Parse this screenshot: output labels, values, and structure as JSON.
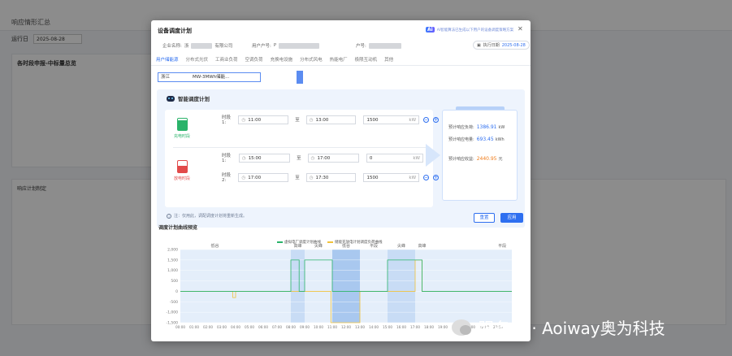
{
  "background": {
    "page_title": "响应情形汇总",
    "filter_label": "运行日",
    "filter_date": "2025-08-28",
    "section_title": "各时段申报-中标量总览",
    "response_label": "响应计划制定"
  },
  "modal": {
    "title": "设备调度计划",
    "ai_badge": "Ai",
    "ai_text": "AI智能算法已生成以下用户的设备调度策略方案",
    "enterprise_label": "企业名称:",
    "enterprise_value": "浙",
    "enterprise_suffix": "有限公司",
    "user_label": "用户户号:",
    "user_value": "P",
    "account_label": "户号:",
    "exec_label": "执行日期",
    "exec_date": "2025-08-28",
    "tabs": [
      "用户储能源",
      "分布式光伏",
      "工商业负荷",
      "空调负荷",
      "充换电设施",
      "分布式风电",
      "热能电厂",
      "极限互动机",
      "其他"
    ],
    "region_value": "浙江",
    "region_value2": "MW-3MWh储能...",
    "plan_title": "智能调度计划",
    "charge_label": "充电时段",
    "discharge_label": "放电时段",
    "to_label": "至",
    "kw_unit": "kW",
    "charge_rows": [
      {
        "label": "时段1:",
        "start": "11:00",
        "end": "13:00",
        "power": "1500"
      }
    ],
    "discharge_rows": [
      {
        "label": "时段1:",
        "start": "15:00",
        "end": "17:00",
        "power": "0"
      },
      {
        "label": "时段2:",
        "start": "17:00",
        "end": "17:30",
        "power": "1500"
      }
    ],
    "note": "注：仅用此，调配调度计划将重新生成。",
    "results": {
      "load_label": "预计响应负荷:",
      "load_value": "1386.91",
      "load_unit": "kW",
      "energy_label": "预计响应电量:",
      "energy_value": "693.45",
      "energy_unit": "kWh",
      "income_label": "预计响应收益:",
      "income_value": "2440.95",
      "income_unit": "元"
    },
    "reset_label": "重置",
    "apply_label": "应用",
    "chart_title": "调度计划曲线预览"
  },
  "chart_data": {
    "type": "line",
    "legend": [
      "虚拟电厂调度计划曲线",
      "储能充放电计划调度负荷曲线"
    ],
    "colors": {
      "dispatch": "#2ab36a",
      "storage": "#f0c23b",
      "band": "#c8dcf5",
      "band_dark": "#a9c8ef"
    },
    "periods": [
      "低谷",
      "高峰",
      "尖峰",
      "低谷",
      "平段",
      "尖峰",
      "高峰",
      "平段"
    ],
    "y_ticks": [
      "2,000",
      "1,500",
      "1,000",
      "500",
      "0",
      "-500",
      "-1,000",
      "-1,500"
    ],
    "x_ticks": [
      "00:00",
      "01:00",
      "02:00",
      "03:00",
      "04:00",
      "05:00",
      "06:00",
      "07:00",
      "08:00",
      "09:00",
      "10:00",
      "11:00",
      "12:00",
      "13:00",
      "14:00",
      "15:00",
      "16:00",
      "17:00",
      "18:00",
      "19:00",
      "20:00",
      "21:00",
      "22:00",
      "23:00"
    ]
  },
  "watermark": "服务号 · Aoiway奥为科技"
}
